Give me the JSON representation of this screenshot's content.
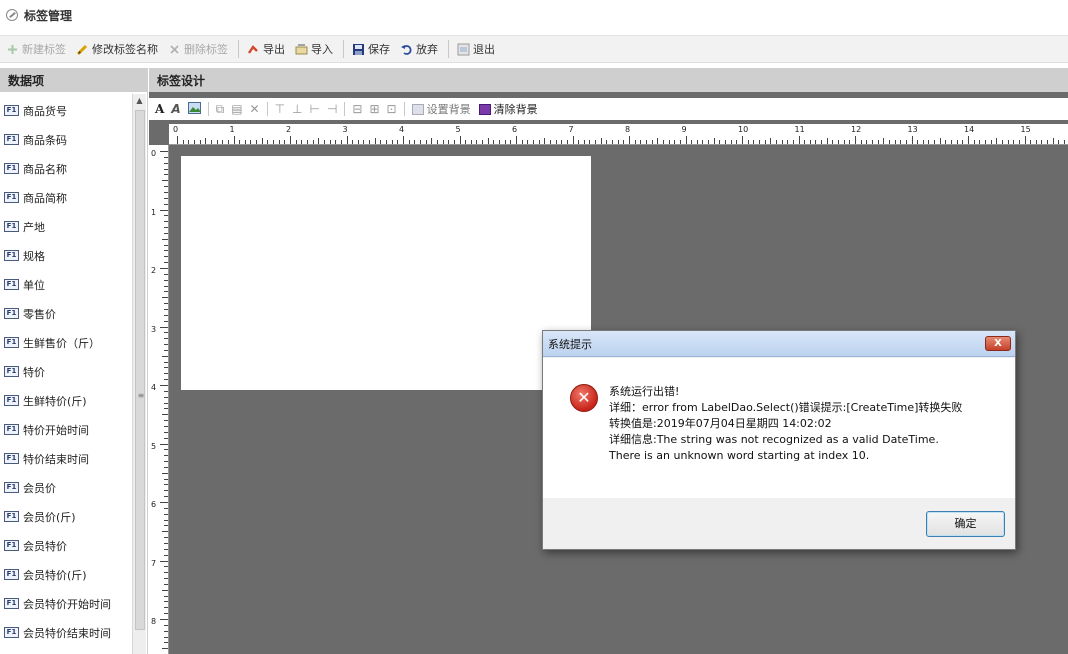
{
  "window": {
    "title": "标签管理",
    "icon": "tag-icon"
  },
  "toolbar": {
    "items": [
      {
        "label": "新建标签",
        "icon": "plus-icon",
        "enabled": false
      },
      {
        "label": "修改标签名称",
        "icon": "pencil-icon",
        "enabled": true
      },
      {
        "label": "删除标签",
        "icon": "delete-x-icon",
        "enabled": false
      },
      {
        "label": "导出",
        "icon": "export-icon",
        "enabled": true
      },
      {
        "label": "导入",
        "icon": "import-icon",
        "enabled": true
      },
      {
        "label": "保存",
        "icon": "save-icon",
        "enabled": true
      },
      {
        "label": "放弃",
        "icon": "undo-icon",
        "enabled": true
      },
      {
        "label": "退出",
        "icon": "exit-icon",
        "enabled": true
      }
    ]
  },
  "left_panel": {
    "title": "数据项",
    "field_badge": "F1",
    "items": [
      "商品货号",
      "商品条码",
      "商品名称",
      "商品简称",
      "产地",
      "规格",
      "单位",
      "零售价",
      "生鲜售价（斤）",
      "特价",
      "生鲜特价(斤)",
      "特价开始时间",
      "特价结束时间",
      "会员价",
      "会员价(斤)",
      "会员特价",
      "会员特价(斤)",
      "会员特价开始时间",
      "会员特价结束时间"
    ]
  },
  "design_panel": {
    "title": "标签设计",
    "set_background_label": "设置背景",
    "clear_background_label": "清除背景",
    "ruler_h_numbers": [
      "0",
      "1",
      "2",
      "3",
      "4",
      "5",
      "6",
      "7",
      "8",
      "9",
      "10",
      "11",
      "12",
      "13",
      "14",
      "15"
    ],
    "ruler_v_numbers": [
      "0",
      "1",
      "2",
      "3",
      "4",
      "5",
      "6",
      "7",
      "8"
    ]
  },
  "dialog": {
    "title": "系统提示",
    "close_label": "X",
    "icon": "error-icon",
    "lines": [
      "系统运行出错!",
      "详细：error from LabelDao.Select()错误提示:[CreateTime]转换失败",
      "转换值是:2019年07月04日星期四 14:02:02",
      "详细信息:The string was not recognized as a valid DateTime.",
      "There is an unknown word starting at index 10."
    ],
    "ok_label": "确定"
  },
  "colors": {
    "canvas_bg": "#6b6b6b",
    "panel_header": "#cfcfcf",
    "error_red": "#c8231a"
  }
}
